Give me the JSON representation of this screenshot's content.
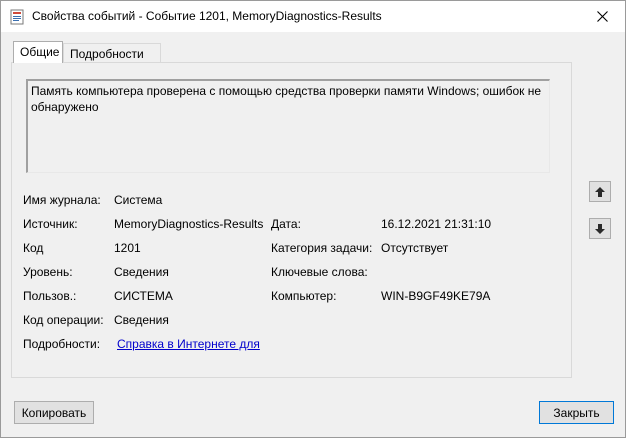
{
  "window": {
    "title": "Свойства событий - Событие 1201, MemoryDiagnostics-Results",
    "icon": "event-viewer-icon",
    "close_icon": "close-icon"
  },
  "tabs": [
    {
      "label": "Общие",
      "active": true
    },
    {
      "label": "Подробности",
      "active": false
    }
  ],
  "description": "Память компьютера проверена с помощью средства проверки памяти Windows; ошибок не обнаружено",
  "fields": {
    "log_name_label": "Имя журнала:",
    "log_name_value": "Система",
    "source_label": "Источник:",
    "source_value": "MemoryDiagnostics-Results",
    "date_label": "Дата:",
    "date_value": "16.12.2021 21:31:10",
    "code_label": "Код",
    "code_value": "1201",
    "task_category_label": "Категория задачи:",
    "task_category_value": "Отсутствует",
    "level_label": "Уровень:",
    "level_value": "Сведения",
    "keywords_label": "Ключевые слова:",
    "keywords_value": "",
    "user_label": "Пользов.:",
    "user_value": "СИСТЕМА",
    "computer_label": "Компьютер:",
    "computer_value": "WIN-B9GF49KE79A",
    "opcode_label": "Код операции:",
    "opcode_value": "Сведения",
    "more_info_label": "Подробности:",
    "more_info_link": "Справка в Интернете для"
  },
  "buttons": {
    "copy_label": "Копировать",
    "close_label": "Закрыть",
    "up_icon": "arrow-up-icon",
    "down_icon": "arrow-down-icon"
  },
  "colors": {
    "link": "#0000cc",
    "default_button_border": "#0078d7",
    "dialog_bg": "#f0f0f0"
  }
}
